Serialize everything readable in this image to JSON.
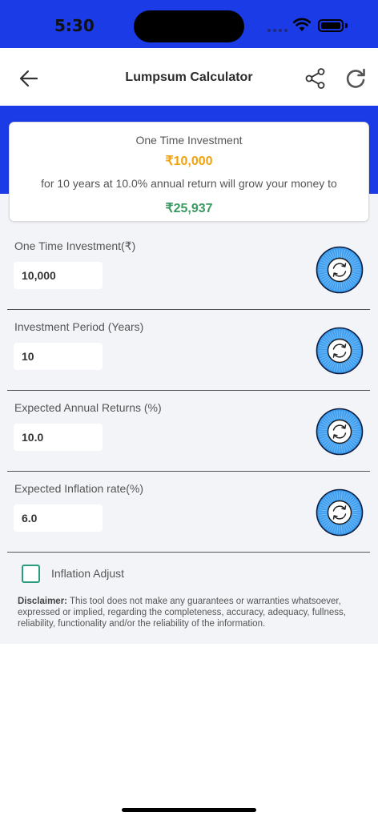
{
  "status_bar": {
    "time": "5:30"
  },
  "nav": {
    "title": "Lumpsum Calculator"
  },
  "summary": {
    "label": "One Time Investment",
    "amount": "₹10,000",
    "description": "for 10 years at 10.0% annual return will grow your money to",
    "result": "₹25,937"
  },
  "fields": [
    {
      "label": "One Time Investment(₹)",
      "value": "10,000"
    },
    {
      "label": "Investment Period (Years)",
      "value": "10"
    },
    {
      "label": "Expected Annual Returns (%)",
      "value": "10.0"
    },
    {
      "label": "Expected Inflation rate(%)",
      "value": "6.0"
    }
  ],
  "inflation_adjust": {
    "label": "Inflation Adjust",
    "checked": false
  },
  "disclaimer": {
    "title": "Disclaimer:",
    "text": " This tool does not make any guarantees or warranties whatsoever, expressed or implied, regarding the completeness, accuracy, adequacy, fullness, reliability, functionality and/or the reliability of the information."
  },
  "colors": {
    "brand_blue": "#1a3be6",
    "amount_orange": "#f2a20c",
    "result_green": "#3b9a63",
    "dial_blue": "#3d9ef0",
    "checkbox_teal": "#2a9b7d"
  },
  "icons": {
    "back": "arrow-left-icon",
    "share": "share-icon",
    "refresh": "refresh-icon",
    "reset": "reset-dial-icon",
    "wifi": "wifi-icon",
    "battery": "battery-icon"
  }
}
